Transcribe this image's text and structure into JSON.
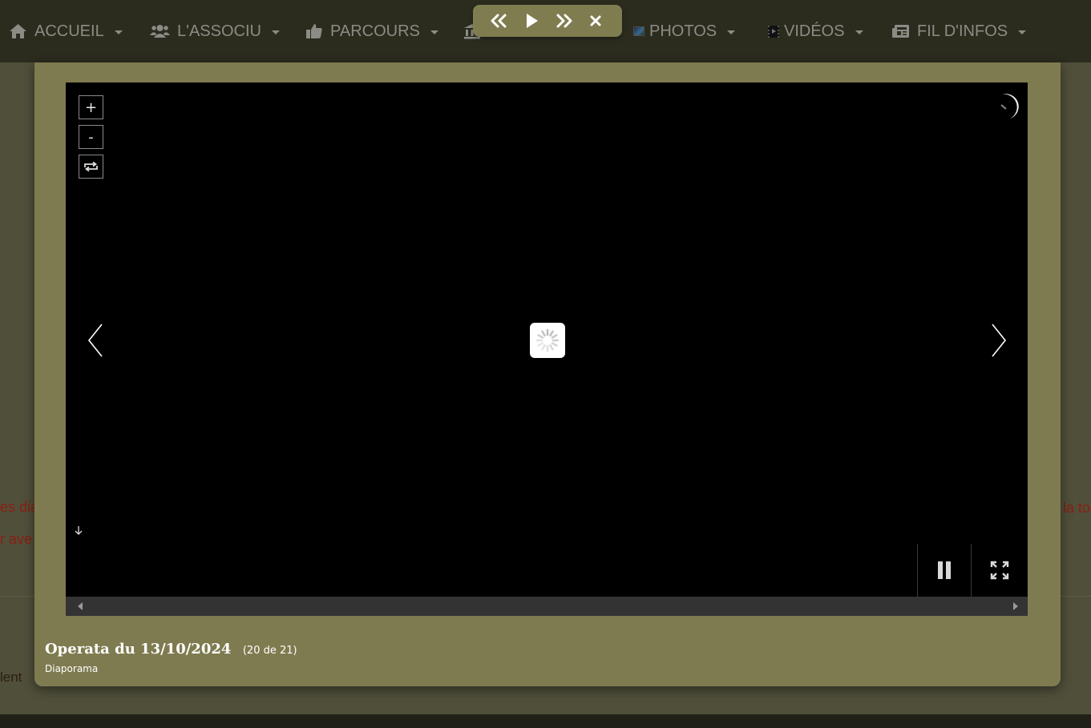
{
  "nav": {
    "items": [
      {
        "label": "ACCUEIL",
        "icon": "home-icon"
      },
      {
        "label": "L'ASSOCIU",
        "icon": "users-icon"
      },
      {
        "label": "PARCOURS",
        "icon": "thumbs-up-icon"
      },
      {
        "label": "",
        "icon": "institution-icon"
      },
      {
        "label": "PHOTOS",
        "icon": "photo-thumbnail-icon"
      },
      {
        "label": "VIDÉOS",
        "icon": "film-icon"
      },
      {
        "label": "FIL D'INFOS",
        "icon": "newspaper-icon"
      }
    ]
  },
  "slideshow_controls": {
    "buttons": [
      "previous",
      "play",
      "next",
      "close"
    ]
  },
  "background_page": {
    "fragments": [
      "es dia",
      "r ave",
      "la to",
      "lent"
    ]
  },
  "viewer": {
    "zoom_in_label": "+",
    "zoom_out_label": "-",
    "status": "loading"
  },
  "caption": {
    "title": "Operata du 13/10/2024",
    "count": "(20 de 21)",
    "subtitle": "Diaporama"
  },
  "colors": {
    "navbar": "#2b2b1e",
    "lightbox": "#7f7b50",
    "page_text": "#8b1e12",
    "nav_text": "#8c8c86"
  }
}
